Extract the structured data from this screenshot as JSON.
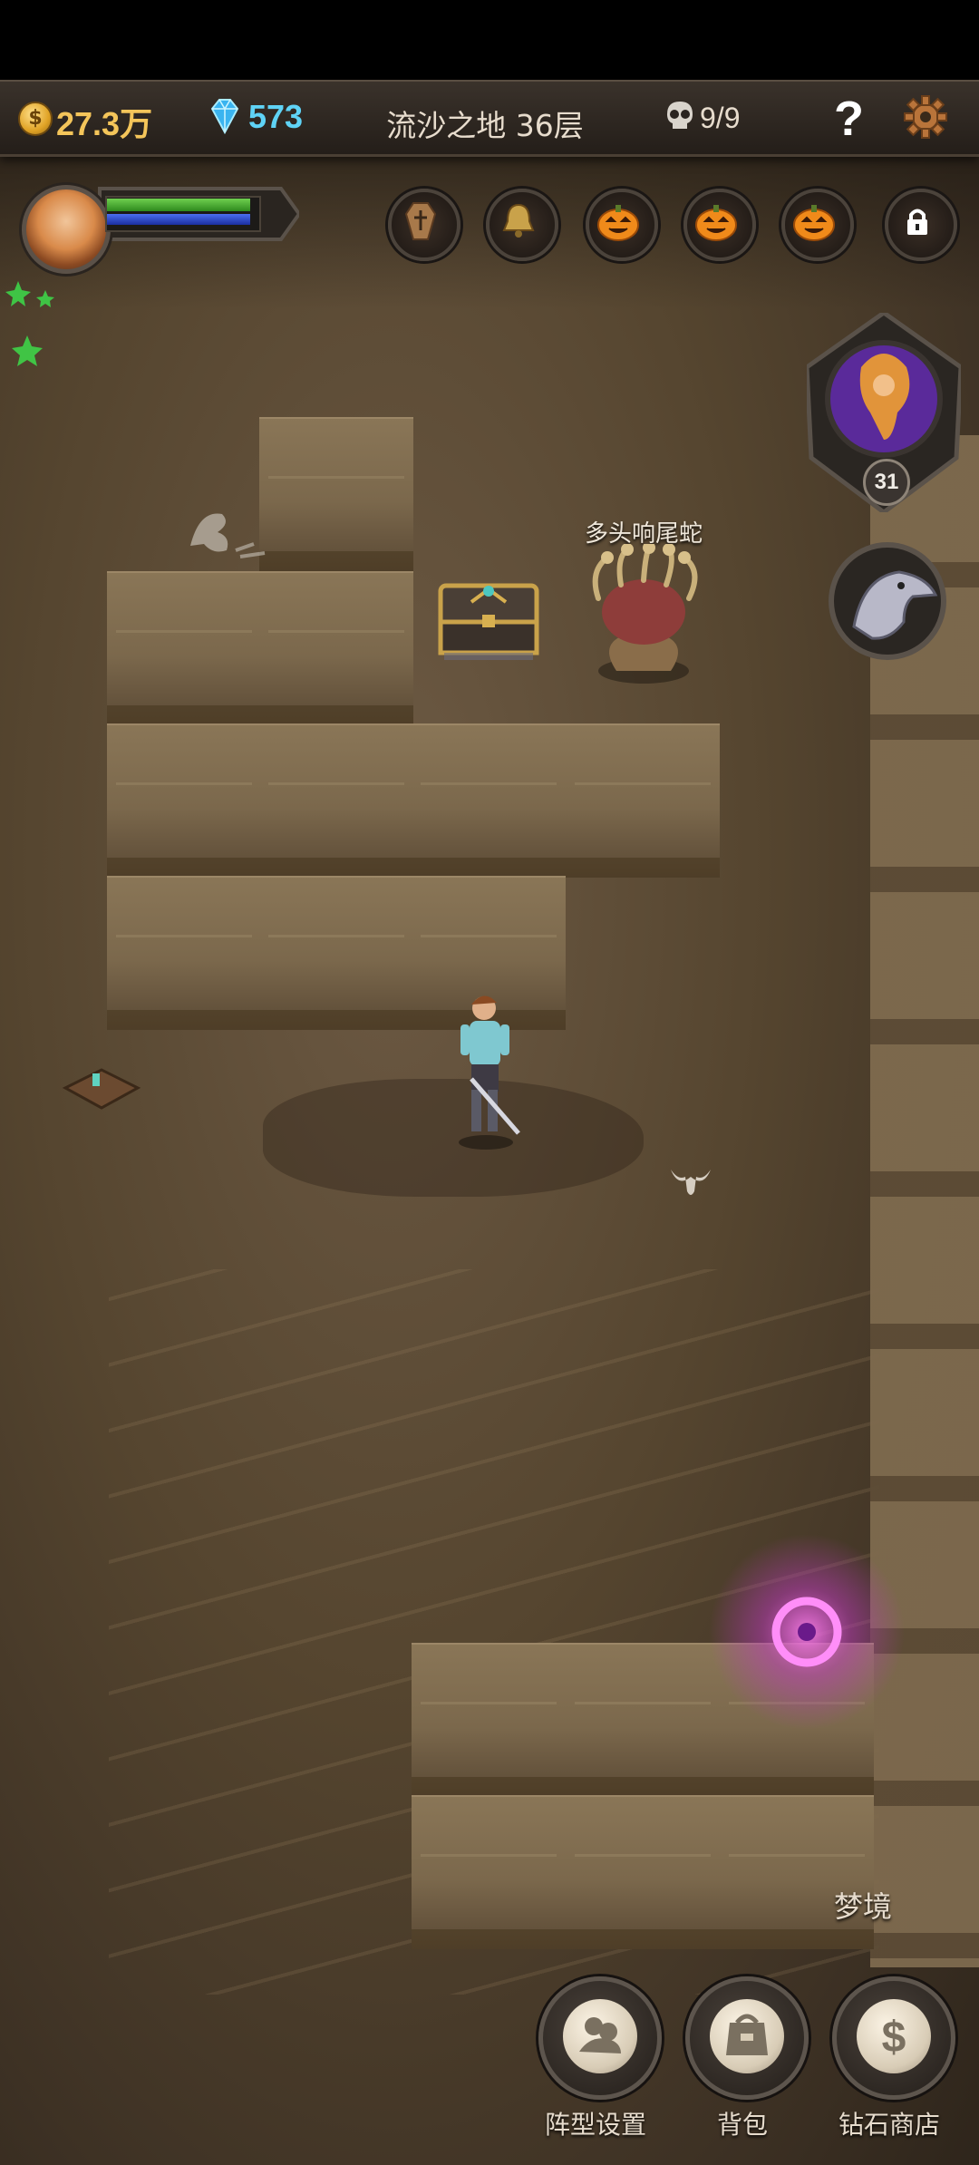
{
  "status": {
    "gold": "27.3万",
    "gems": "573",
    "level_title": "流沙之地 36层",
    "kills": "9/9"
  },
  "hero": {
    "icon": "hero-portrait",
    "hp_fraction": 1.0,
    "mp_fraction": 1.0
  },
  "skill_slots": [
    {
      "icon": "coffin-icon"
    },
    {
      "icon": "bell-icon"
    },
    {
      "icon": "pumpkin-icon"
    },
    {
      "icon": "pumpkin-icon"
    },
    {
      "icon": "pumpkin-icon"
    },
    {
      "icon": "lock-icon"
    }
  ],
  "boss": {
    "level": "31",
    "icon": "fire-dancer-portrait"
  },
  "enemy": {
    "name": "多头响尾蛇"
  },
  "map_label": "梦境",
  "menu": [
    {
      "label": "阵型设置",
      "icon": "formation-icon"
    },
    {
      "label": "背包",
      "icon": "backpack-icon"
    },
    {
      "label": "钻石商店",
      "icon": "dollar-icon"
    }
  ],
  "colors": {
    "gold": "#f4c55a",
    "gem": "#5fd3f6",
    "hp": "#2e8a1d",
    "mp": "#1b2fa0",
    "portal": "#d84ad8"
  }
}
